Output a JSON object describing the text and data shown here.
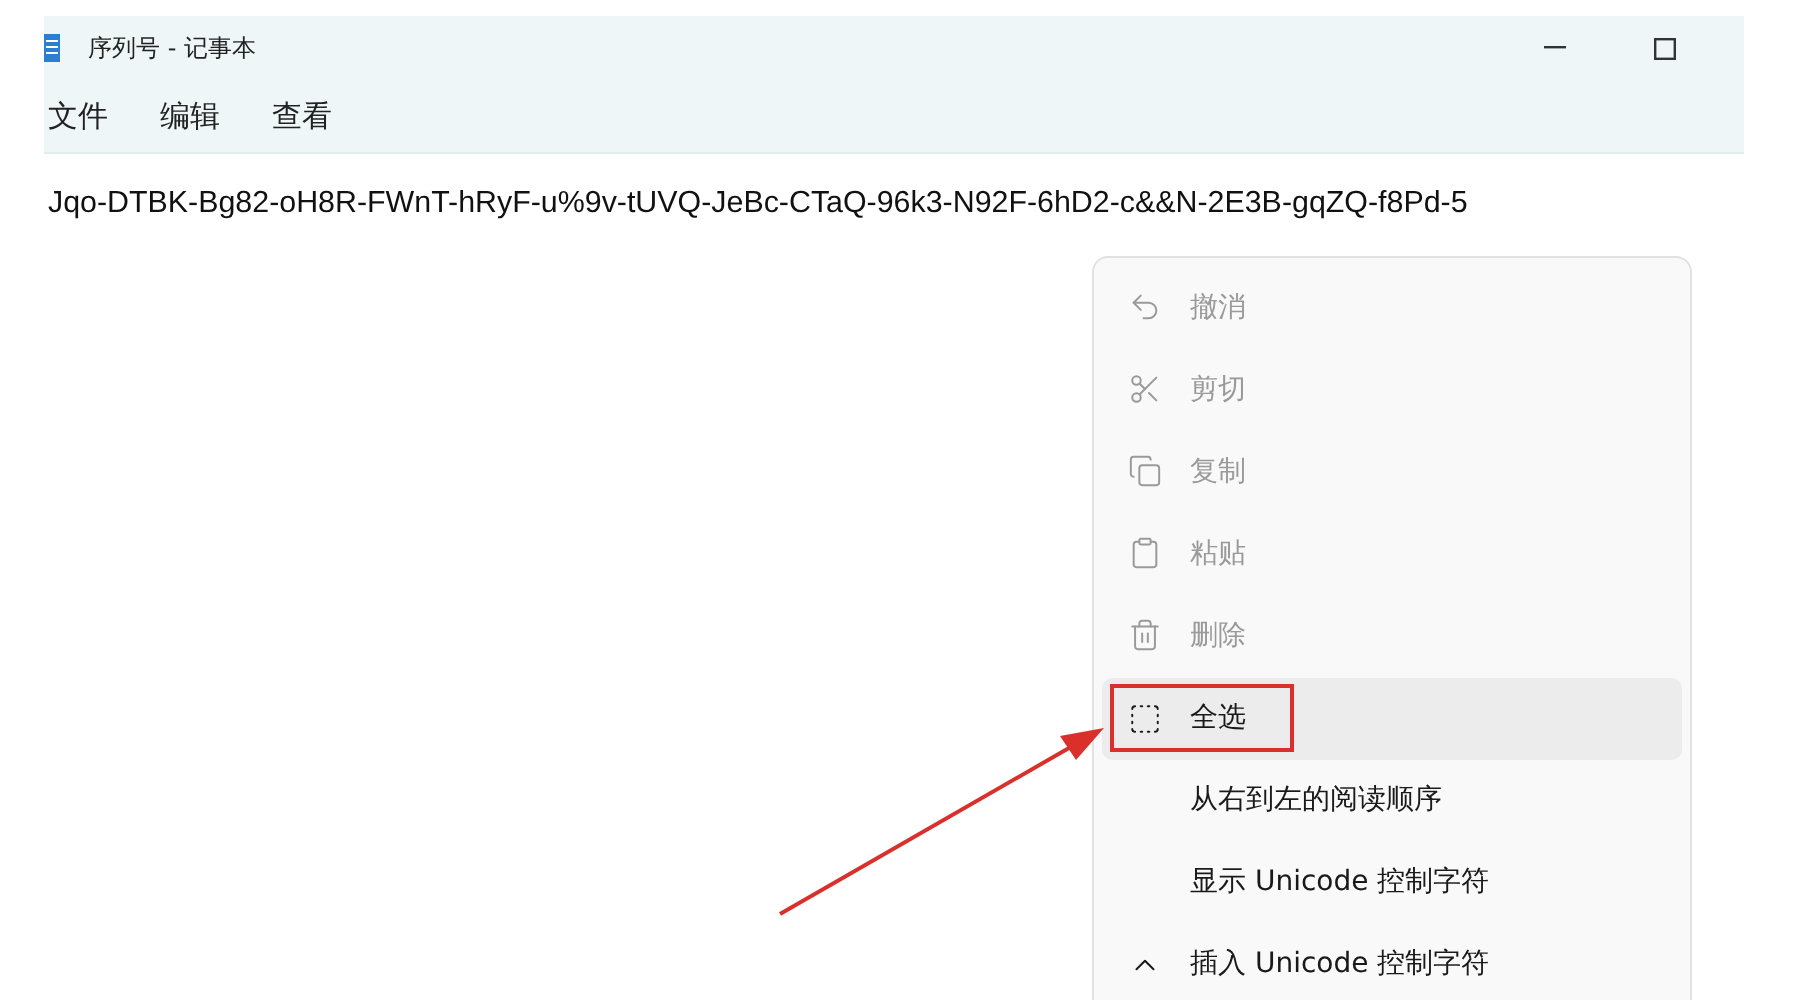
{
  "window": {
    "title": "序列号 - 记事本"
  },
  "menu_bar": [
    "文件",
    "编辑",
    "查看"
  ],
  "document": {
    "text": "Jqo-DTBK-Bg82-oH8R-FWnT-hRyF-u%9v-tUVQ-JeBc-CTaQ-96k3-N92F-6hD2-c&&N-2E3B-gqZQ-f8Pd-5"
  },
  "context_menu": {
    "items": [
      {
        "label": "撤消",
        "disabled": true,
        "selected": false,
        "boxed": false
      },
      {
        "label": "剪切",
        "disabled": true,
        "selected": false,
        "boxed": false
      },
      {
        "label": "复制",
        "disabled": true,
        "selected": false,
        "boxed": false
      },
      {
        "label": "粘贴",
        "disabled": true,
        "selected": false,
        "boxed": false
      },
      {
        "label": "删除",
        "disabled": true,
        "selected": false,
        "boxed": false
      },
      {
        "label": "全选",
        "disabled": false,
        "selected": true,
        "boxed": true
      },
      {
        "label": "从右到左的阅读顺序",
        "disabled": false,
        "selected": false,
        "boxed": false
      },
      {
        "label": "显示 Unicode 控制字符",
        "disabled": false,
        "selected": false,
        "boxed": false
      },
      {
        "label": "插入 Unicode 控制字符",
        "disabled": false,
        "selected": false,
        "boxed": false
      }
    ]
  }
}
